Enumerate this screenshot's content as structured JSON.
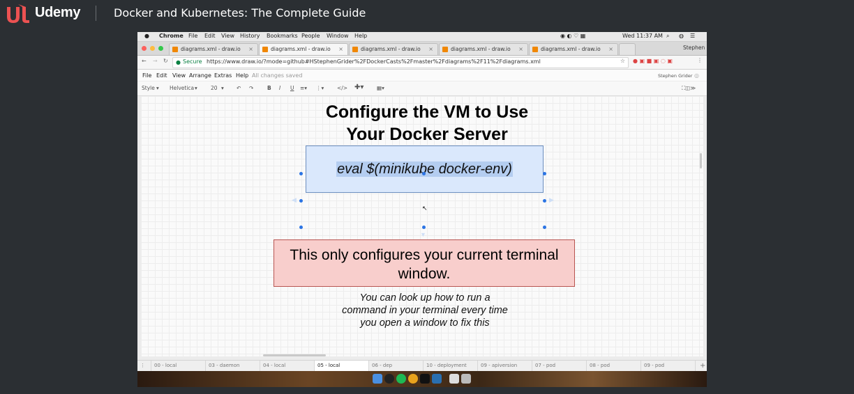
{
  "udemy": {
    "brand": "Udemy",
    "course_title": "Docker and Kubernetes: The Complete Guide"
  },
  "mac_menu": {
    "app": "Chrome",
    "items": [
      "File",
      "Edit",
      "View",
      "History",
      "Bookmarks",
      "People",
      "Window",
      "Help"
    ],
    "clock": "Wed 11:37 AM"
  },
  "browser": {
    "tabs": [
      {
        "label": "diagrams.xml - draw.io",
        "active": false
      },
      {
        "label": "diagrams.xml - draw.io",
        "active": true
      },
      {
        "label": "diagrams.xml - draw.io",
        "active": false
      },
      {
        "label": "diagrams.xml - draw.io",
        "active": false
      },
      {
        "label": "diagrams.xml - draw.io",
        "active": false
      }
    ],
    "profile": "Stephen",
    "secure_label": "Secure",
    "url": "https://www.draw.io/?mode=github#HStephenGrider%2FDockerCasts%2Fmaster%2Fdiagrams%2F11%2Fdiagrams.xml"
  },
  "drawio": {
    "menu": [
      "File",
      "Edit",
      "View",
      "Arrange",
      "Extras",
      "Help"
    ],
    "save_status": "All changes saved",
    "user": "Stephen Grider",
    "toolbar": {
      "style": "Style",
      "font": "Helvetica",
      "size": "20"
    },
    "title_line1": "Configure the VM to Use",
    "title_line2": "Your Docker Server",
    "command": "eval $(minikube docker-env)",
    "warning": "This only configures your current terminal window.",
    "note": "You can look up how to run a command in your terminal every time you open a window to fix this",
    "pages": [
      {
        "label": "00 - local",
        "active": false
      },
      {
        "label": "03 - daemon",
        "active": false
      },
      {
        "label": "04 - local",
        "active": false
      },
      {
        "label": "05 - local",
        "active": true
      },
      {
        "label": "06 - dep",
        "active": false
      },
      {
        "label": "10 - deployment",
        "active": false
      },
      {
        "label": "09 - apiversion",
        "active": false
      },
      {
        "label": "07 - pod",
        "active": false
      },
      {
        "label": "08 - pod",
        "active": false
      },
      {
        "label": "09 - pod",
        "active": false
      }
    ]
  },
  "colors": {
    "accent": "#ec5252",
    "box_blue_fill": "#dae8fc",
    "box_red_fill": "#f8cecc"
  }
}
